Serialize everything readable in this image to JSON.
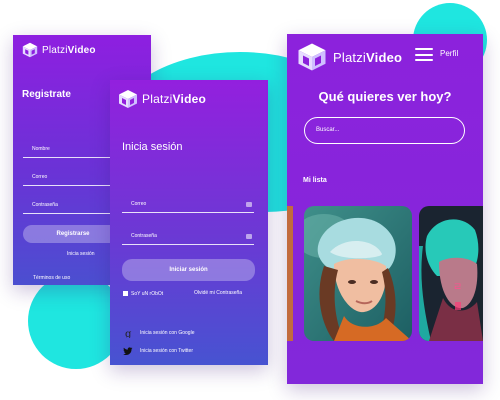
{
  "brand": {
    "name_light": "Platzi",
    "name_bold": "Video"
  },
  "register_screen": {
    "title": "Registrate",
    "fields": [
      {
        "label": "Nombre"
      },
      {
        "label": "Correo"
      },
      {
        "label": "Contraseña"
      }
    ],
    "submit_label": "Registrarse",
    "login_link": "Inicia sesión",
    "terms_link": "Términos de uso"
  },
  "login_screen": {
    "title": "Inicia sesión",
    "fields": [
      {
        "label": "Correo"
      },
      {
        "label": "Contraseña"
      }
    ],
    "submit_label": "Iniciar sesión",
    "remember_label": "SoY uN rObOt",
    "forgot_link": "Olvidé mi Contraseña",
    "google_label": "Inicia sesión con Google",
    "twitter_label": "Inicia sesión con Twitter"
  },
  "home_screen": {
    "menu_label": "Perfil",
    "headline": "Qué quieres ver hoy?",
    "search_placeholder": "Buscar...",
    "list_title": "Mi lista"
  },
  "colors": {
    "accent_cyan": "#1fe6e0",
    "purple_top": "#8e1fe0",
    "purple_bottom": "#4b4fd0"
  }
}
